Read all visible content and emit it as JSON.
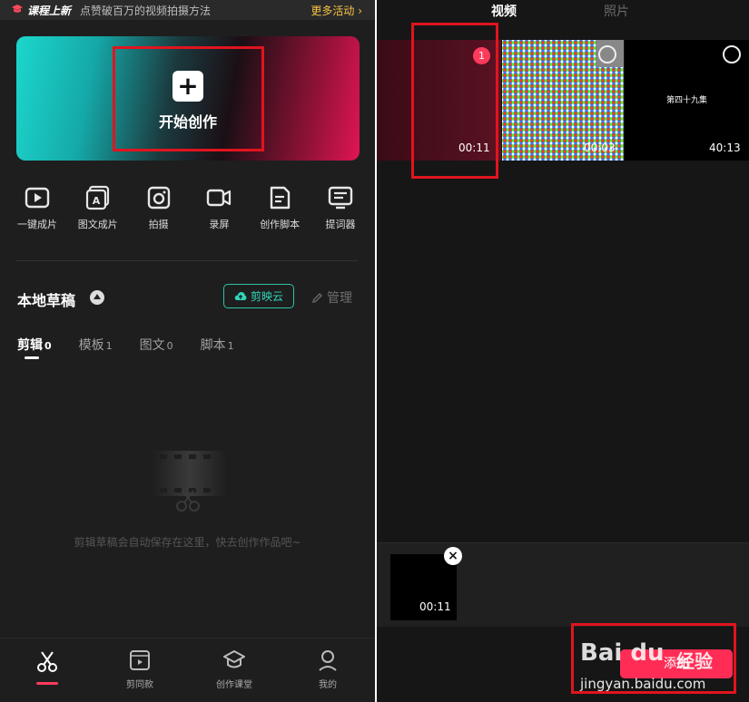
{
  "banner": {
    "title": "课程上新",
    "subtitle": "点赞破百万的视频拍摄方法",
    "more": "更多活动 ›"
  },
  "create": {
    "label": "开始创作"
  },
  "tools": [
    {
      "icon": "play-icon",
      "label": "一键成片"
    },
    {
      "icon": "image-text-icon",
      "label": "图文成片"
    },
    {
      "icon": "camera-icon",
      "label": "拍摄"
    },
    {
      "icon": "video-camera-icon",
      "label": "录屏"
    },
    {
      "icon": "script-icon",
      "label": "创作脚本"
    },
    {
      "icon": "teleprompter-icon",
      "label": "提词器"
    }
  ],
  "drafts": {
    "title": "本地草稿",
    "cloud": "剪映云",
    "manage": "管理",
    "tabs": [
      {
        "label": "剪辑",
        "count": "0"
      },
      {
        "label": "模板",
        "count": "1"
      },
      {
        "label": "图文",
        "count": "0"
      },
      {
        "label": "脚本",
        "count": "1"
      }
    ],
    "empty_text": "剪辑草稿会自动保存在这里，快去创作作品吧~"
  },
  "nav": [
    {
      "icon": "scissors-icon",
      "label": ""
    },
    {
      "icon": "template-icon",
      "label": "剪同款"
    },
    {
      "icon": "graduation-cap-icon",
      "label": "创作课堂"
    },
    {
      "icon": "user-icon",
      "label": "我的"
    }
  ],
  "picker": {
    "tabs": [
      "视频",
      "照片"
    ],
    "items": [
      {
        "duration": "00:11",
        "selected_index": "1"
      },
      {
        "duration": "00:03"
      },
      {
        "duration": "40:13",
        "caption": "第四十九集"
      }
    ],
    "tray": [
      {
        "duration": "00:11"
      }
    ],
    "add_label": "添加"
  },
  "watermark": {
    "brand": "Bai du",
    "brand_cn": "经验",
    "url": "jingyan.baidu.com"
  },
  "colors": {
    "accent": "#ff2d55",
    "cloud": "#2fc3a8",
    "highlight_box": "#e0141e"
  }
}
